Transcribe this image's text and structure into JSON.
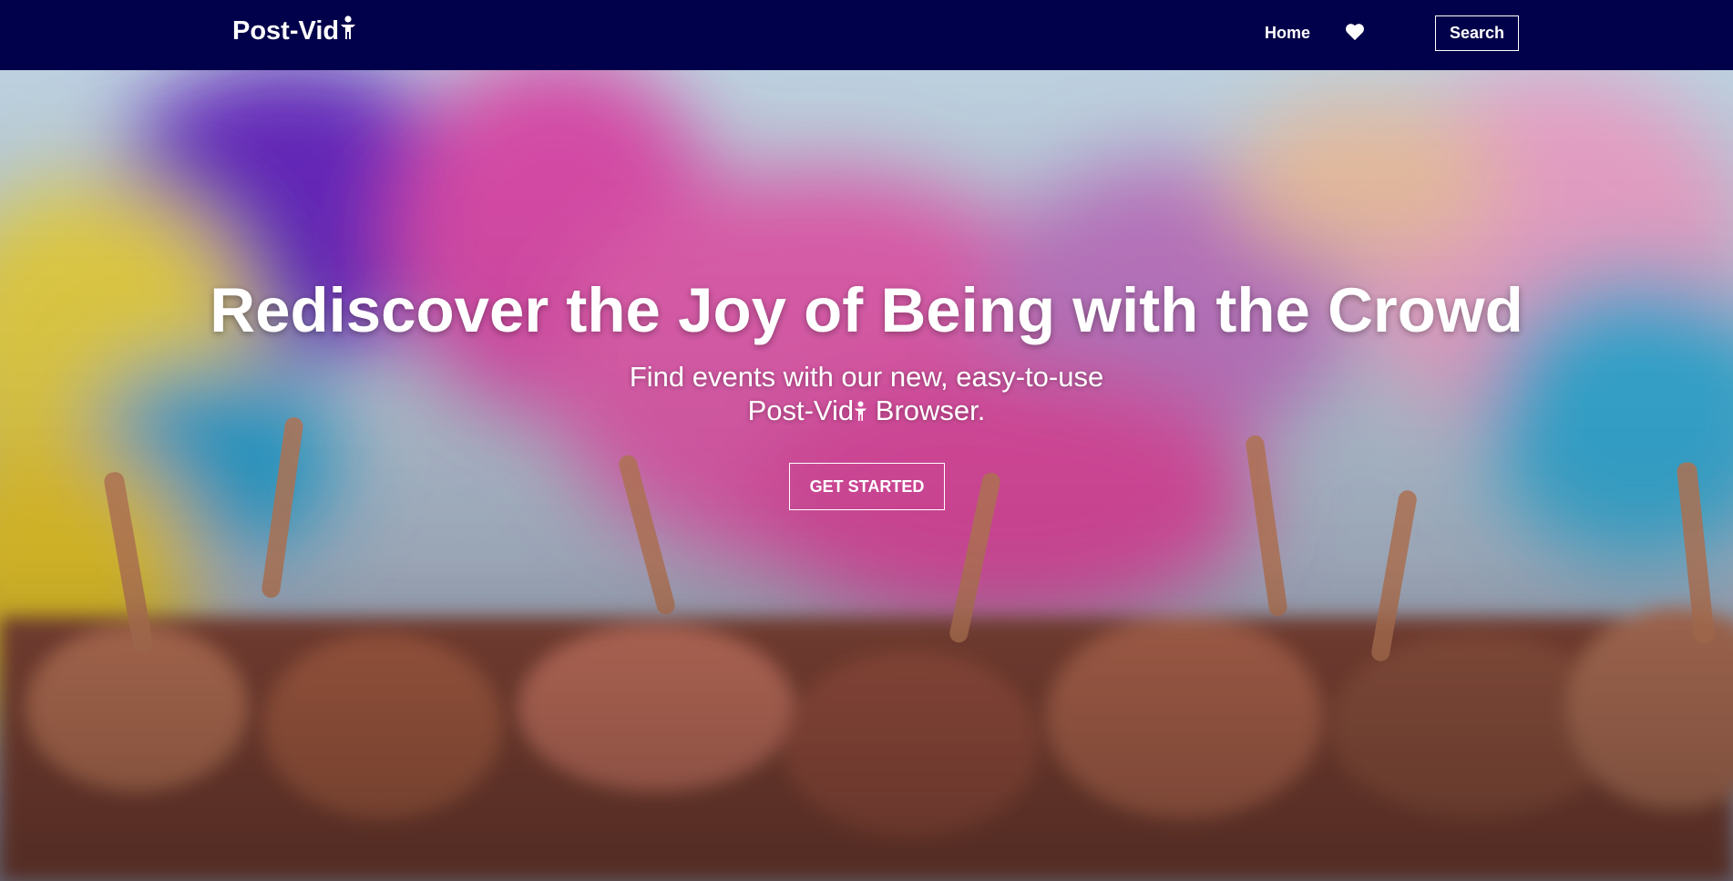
{
  "navbar": {
    "brand": "Post-Vid",
    "brand_icon": "person-icon",
    "home": "Home",
    "favorites_icon": "heart-icon",
    "search": "Search"
  },
  "hero": {
    "headline": "Rediscover the Joy of Being with the Crowd",
    "sub_line1": "Find events with our new, easy-to-use",
    "sub_line2_prefix": "Post-Vid",
    "sub_line2_suffix": " Browser.",
    "cta": "GET STARTED",
    "background": "crowd-with-color-powder-image"
  },
  "colors": {
    "nav_bg": "#01004a",
    "text": "#ffffff"
  }
}
